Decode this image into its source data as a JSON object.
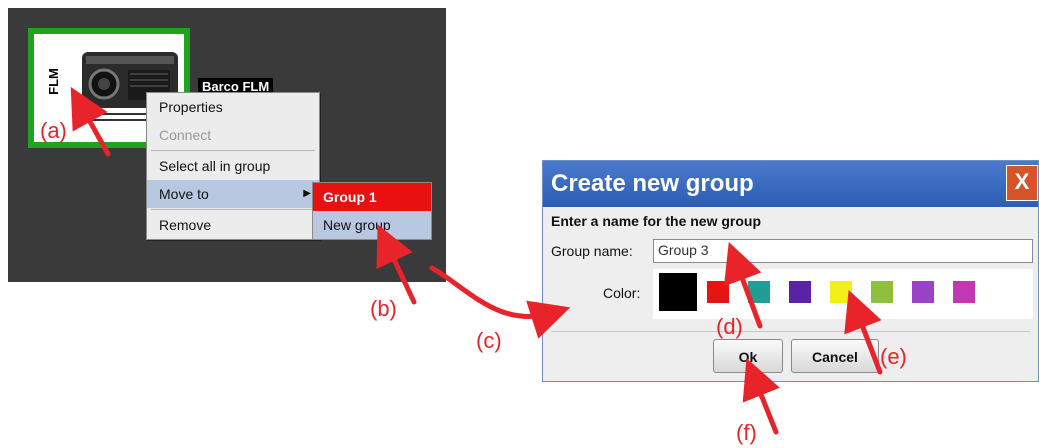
{
  "device": {
    "tag": "FLM",
    "label": "Barco FLM"
  },
  "context_menu": {
    "items": [
      {
        "label": "Properties"
      },
      {
        "label": "Connect",
        "disabled": true
      },
      {
        "label": "Select all in group"
      },
      {
        "label": "Move to",
        "submenu_icon": "chevron-right-icon"
      },
      {
        "label": "Remove"
      }
    ]
  },
  "submenu": {
    "items": [
      {
        "label": "Group 1"
      },
      {
        "label": "New group"
      }
    ]
  },
  "dialog": {
    "title": "Create new group",
    "close_label": "X",
    "prompt": "Enter a name for the new group",
    "group_name_label": "Group name:",
    "group_name_value": "Group 3",
    "color_label": "Color:",
    "colors": [
      "#000000",
      "#e81313",
      "#1f9e96",
      "#5a22a6",
      "#f2ef1a",
      "#8fbf3b",
      "#9b43c6",
      "#c437b3"
    ],
    "ok_label": "Ok",
    "cancel_label": "Cancel"
  },
  "annotations": {
    "a": "(a)",
    "b": "(b)",
    "c": "(c)",
    "d": "(d)",
    "e": "(e)",
    "f": "(f)"
  },
  "accent_colors": {
    "annotation": "#e8242a",
    "selection_border": "#21a321"
  }
}
